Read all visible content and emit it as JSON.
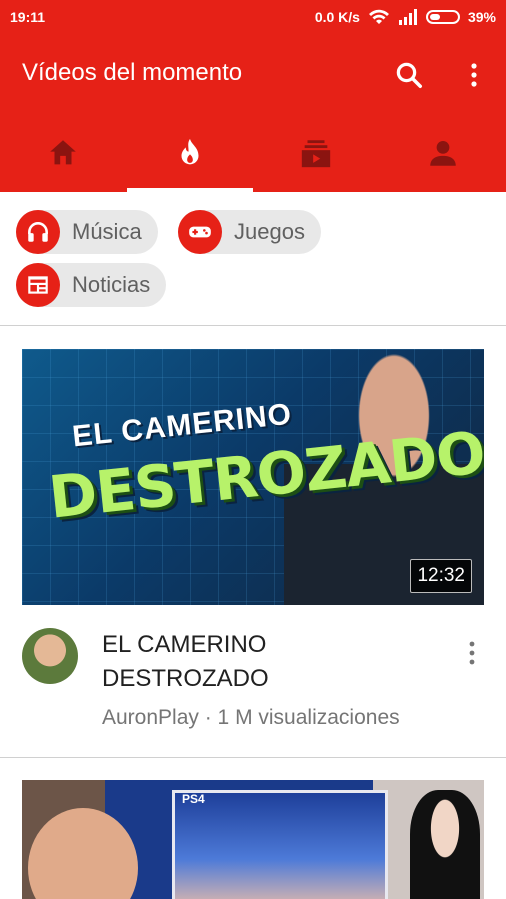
{
  "status_bar": {
    "time": "19:11",
    "network_speed": "0.0 K/s",
    "battery_percent": "39%",
    "battery_level": 0.39,
    "icons": [
      "wifi-icon",
      "signal-icon",
      "battery-icon"
    ]
  },
  "app_bar": {
    "title": "Vídeos del momento",
    "icons": [
      "search-icon",
      "more-vertical-icon"
    ]
  },
  "tabs": [
    {
      "name": "home",
      "icon": "home-icon",
      "active": false
    },
    {
      "name": "trending",
      "icon": "flame-icon",
      "active": true
    },
    {
      "name": "subscriptions",
      "icon": "subscriptions-icon",
      "active": false
    },
    {
      "name": "account",
      "icon": "person-icon",
      "active": false
    }
  ],
  "chips": [
    {
      "label": "Música",
      "icon": "headphones-icon"
    },
    {
      "label": "Juegos",
      "icon": "gamepad-icon"
    },
    {
      "label": "Noticias",
      "icon": "newspaper-icon"
    }
  ],
  "videos": [
    {
      "thumbnail_text_line1": "EL CAMERINO",
      "thumbnail_text_line2": "DESTROZADO",
      "duration": "12:32",
      "title": "EL CAMERINO DESTROZADO",
      "channel": "AuronPlay",
      "views": "1 M visualizaciones",
      "meta": "AuronPlay · 1 M visualizaciones"
    },
    {
      "thumbnail_text": "PS4"
    }
  ],
  "colors": {
    "brand_red": "#e62117",
    "chip_background": "#e8e8e8",
    "thumbnail_title_green": "#b7f26a"
  }
}
